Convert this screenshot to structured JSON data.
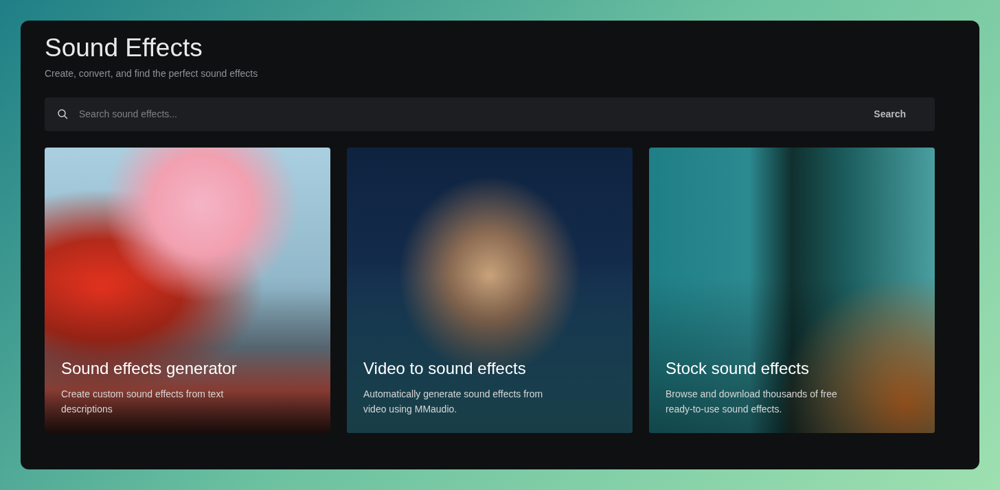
{
  "header": {
    "title": "Sound Effects",
    "subtitle": "Create, convert, and find the perfect sound effects"
  },
  "search": {
    "placeholder": "Search sound effects...",
    "button": "Search"
  },
  "cards": [
    {
      "title": "Sound effects generator",
      "description": "Create custom sound effects from text descriptions"
    },
    {
      "title": "Video to sound effects",
      "description": "Automatically generate sound effects from video using MMaudio."
    },
    {
      "title": "Stock sound effects",
      "description": "Browse and download thousands of free ready-to-use sound effects."
    }
  ]
}
